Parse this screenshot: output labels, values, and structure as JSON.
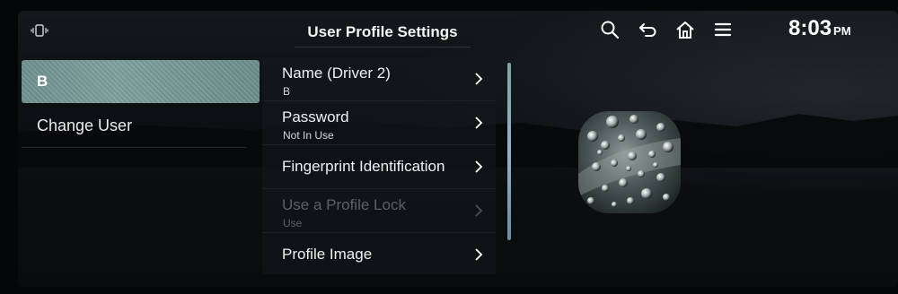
{
  "header": {
    "title": "User Profile Settings",
    "clock_time": "8:03",
    "clock_ampm": "PM",
    "icons": [
      "status-icon",
      "search-icon",
      "back-icon",
      "home-icon",
      "menu-icon"
    ]
  },
  "users": {
    "selected": "B",
    "change_user_label": "Change User"
  },
  "menu": {
    "items": [
      {
        "label": "Name (Driver 2)",
        "sub": "B",
        "enabled": true
      },
      {
        "label": "Password",
        "sub": "Not In Use",
        "enabled": true
      },
      {
        "label": "Fingerprint Identification",
        "sub": "",
        "enabled": true
      },
      {
        "label": "Use a Profile Lock",
        "sub": "Use",
        "enabled": false
      },
      {
        "label": "Profile Image",
        "sub": "",
        "enabled": true
      }
    ]
  },
  "colors": {
    "accent": "#7ea09d",
    "scrollbar": "#8fb4c8",
    "disabled_text": "#5a6166"
  }
}
